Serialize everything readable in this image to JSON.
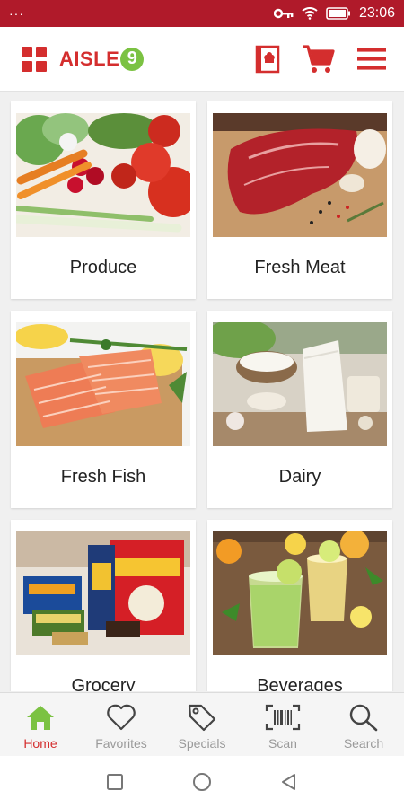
{
  "status_bar": {
    "notification_dots": "···",
    "time": "23:06"
  },
  "header": {
    "brand_name": "AISLE",
    "brand_suffix": "9"
  },
  "categories": [
    {
      "label": "Produce",
      "image": "vegetables-photo"
    },
    {
      "label": "Fresh Meat",
      "image": "steak-photo"
    },
    {
      "label": "Fresh Fish",
      "image": "salmon-photo"
    },
    {
      "label": "Dairy",
      "image": "milk-photo"
    },
    {
      "label": "Grocery",
      "image": "packaged-goods-photo"
    },
    {
      "label": "Beverages",
      "image": "drinks-photo"
    }
  ],
  "bottom_nav": {
    "items": [
      {
        "label": "Home",
        "icon": "home-icon",
        "active": true
      },
      {
        "label": "Favorites",
        "icon": "heart-icon",
        "active": false
      },
      {
        "label": "Specials",
        "icon": "tag-icon",
        "active": false
      },
      {
        "label": "Scan",
        "icon": "barcode-scan-icon",
        "active": false
      },
      {
        "label": "Search",
        "icon": "search-icon",
        "active": false
      }
    ]
  },
  "colors": {
    "brand_red": "#d42e2e",
    "status_bar": "#b01a2a",
    "brand_green": "#7bc242",
    "inactive_gray": "#9a9a9a"
  }
}
